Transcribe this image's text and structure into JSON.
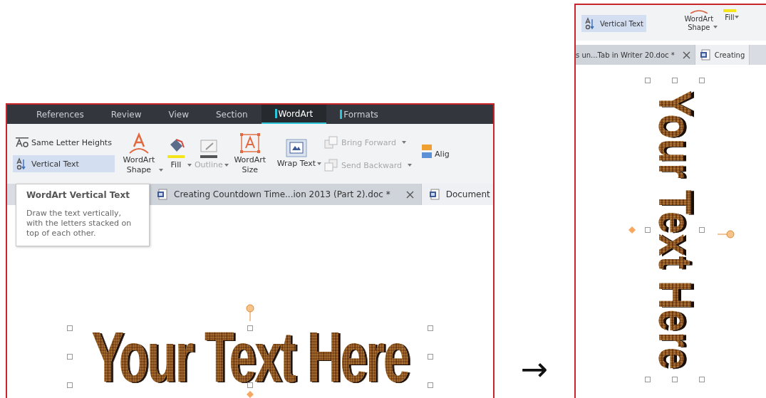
{
  "panels": [
    {
      "kind": "horizontal",
      "ribbon_tabs": [
        {
          "label": "References",
          "selected": false,
          "marked": false
        },
        {
          "label": "Review",
          "selected": false,
          "marked": false
        },
        {
          "label": "View",
          "selected": false,
          "marked": false
        },
        {
          "label": "Section",
          "selected": false,
          "marked": false
        },
        {
          "label": "WordArt",
          "selected": true,
          "marked": true
        },
        {
          "label": "Formats",
          "selected": false,
          "marked": true
        }
      ],
      "ribbon_columns": [
        {
          "items": [
            {
              "kind": "letter-heights",
              "label": "Same Letter Heights",
              "selected": false,
              "disabled": false,
              "dropdown": false
            },
            {
              "kind": "vertical-text",
              "label": "Vertical Text",
              "selected": true,
              "disabled": false,
              "dropdown": false
            }
          ]
        },
        {
          "items": [
            {
              "kind": "shape",
              "label": "WordArt Shape",
              "selected": false,
              "disabled": false,
              "dropdown": true
            }
          ]
        },
        {
          "items": [
            {
              "kind": "fill",
              "label": "Fill",
              "selected": false,
              "disabled": false,
              "dropdown": true
            }
          ]
        },
        {
          "items": [
            {
              "kind": "outline",
              "label": "Outline",
              "selected": false,
              "disabled": true,
              "dropdown": true
            }
          ]
        },
        {
          "items": [
            {
              "kind": "size",
              "label": "WordArt Size",
              "selected": false,
              "disabled": false,
              "dropdown": false
            }
          ]
        },
        {
          "items": [
            {
              "kind": "wrap",
              "label": "Wrap Text",
              "selected": false,
              "disabled": false,
              "dropdown": true
            }
          ]
        },
        {
          "items": [
            {
              "kind": "bring-forward",
              "label": "Bring Forward",
              "selected": false,
              "disabled": true,
              "dropdown": true
            },
            {
              "kind": "send-backward",
              "label": "Send Backward",
              "selected": false,
              "disabled": true,
              "dropdown": true
            }
          ]
        },
        {
          "items": [
            {
              "kind": "align",
              "label": "Alig",
              "selected": false,
              "disabled": false,
              "dropdown": false
            }
          ]
        }
      ],
      "doc_tabs": [
        {
          "label": "Creating Countdown Time...ion 2013 (Part 2).doc *",
          "selected": true,
          "closable": true
        },
        {
          "label": "Document",
          "selected": false,
          "closable": false
        }
      ],
      "tooltip": {
        "title": "WordArt Vertical Text",
        "body": "Draw the text vertically, with the letters stacked on top of each other."
      },
      "wordart": {
        "text": "Your Text Here",
        "vertical": false
      }
    },
    {
      "kind": "vertical",
      "ribbon_columns": [
        {
          "items": [
            {
              "kind": "vertical-text",
              "label": "Vertical Text",
              "selected": true,
              "disabled": false,
              "dropdown": false
            }
          ]
        },
        {
          "items": [
            {
              "kind": "shape",
              "label": "WordArt Shape",
              "selected": false,
              "disabled": false,
              "dropdown": true
            }
          ]
        },
        {
          "items": [
            {
              "kind": "fill",
              "label": "Fill",
              "selected": false,
              "disabled": false,
              "dropdown": true
            }
          ]
        }
      ],
      "doc_tabs": [
        {
          "label": "s un...Tab in Writer 20.doc *",
          "selected": true,
          "closable": true
        },
        {
          "label": "Creating",
          "selected": false,
          "closable": false
        }
      ],
      "wordart": {
        "text": "Your Text Here",
        "vertical": true
      }
    }
  ],
  "arrow": "→"
}
